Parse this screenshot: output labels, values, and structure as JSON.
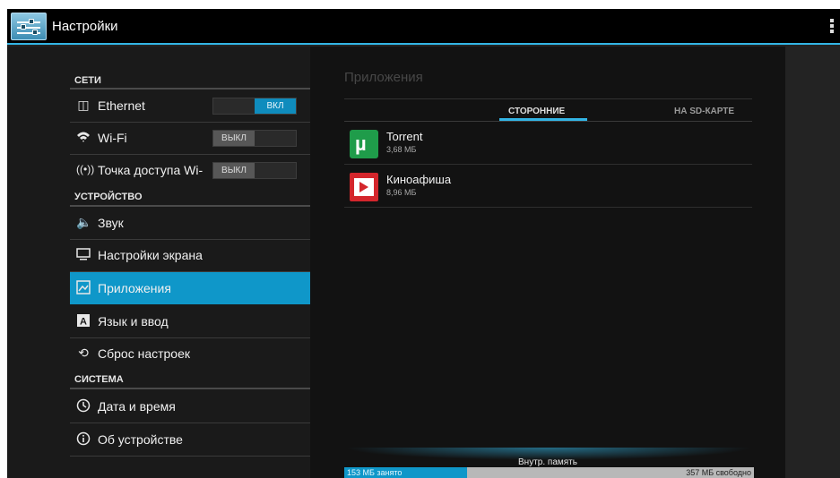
{
  "actionbar": {
    "title": "Настройки"
  },
  "left_pane": {
    "sections": [
      {
        "header": "СЕТИ",
        "items": [
          {
            "label": "Ethernet",
            "icon": "ethernet-icon",
            "toggle": "ВКЛ",
            "toggle_on": true
          },
          {
            "label": "Wi-Fi",
            "icon": "wifi-icon",
            "toggle": "ВЫКЛ",
            "toggle_on": false
          },
          {
            "label": "Точка доступа Wi-",
            "icon": "hotspot-icon",
            "toggle": "ВЫКЛ",
            "toggle_on": false
          }
        ]
      },
      {
        "header": "УСТРОЙСТВО",
        "items": [
          {
            "label": "Звук",
            "icon": "speaker-icon"
          },
          {
            "label": "Настройки экрана",
            "icon": "display-icon"
          },
          {
            "label": "Приложения",
            "icon": "apps-icon",
            "selected": true
          },
          {
            "label": "Язык и ввод",
            "icon": "language-icon"
          },
          {
            "label": "Сброс настроек",
            "icon": "restore-icon"
          }
        ]
      },
      {
        "header": "СИСТЕМА",
        "items": [
          {
            "label": "Дата и время",
            "icon": "clock-icon"
          },
          {
            "label": "Об устройстве",
            "icon": "info-icon"
          }
        ]
      }
    ]
  },
  "right_pane": {
    "title": "Приложения",
    "tabs": [
      {
        "label": "СТОРОННИЕ",
        "active": true
      },
      {
        "label": "НА SD-КАРТЕ",
        "active": false
      }
    ],
    "apps": [
      {
        "name": "Torrent",
        "size": "3,68 МБ",
        "icon": "utorrent-icon"
      },
      {
        "name": "Киноафиша",
        "size": "8,96 МБ",
        "icon": "film-play-icon"
      }
    ],
    "storage": {
      "label": "Внутр. память",
      "used": "153 МБ занято",
      "free": "357 МБ свободно",
      "used_fraction": 0.3
    }
  },
  "colors": {
    "accent": "#33b5e5",
    "selected": "#0f97c9"
  }
}
